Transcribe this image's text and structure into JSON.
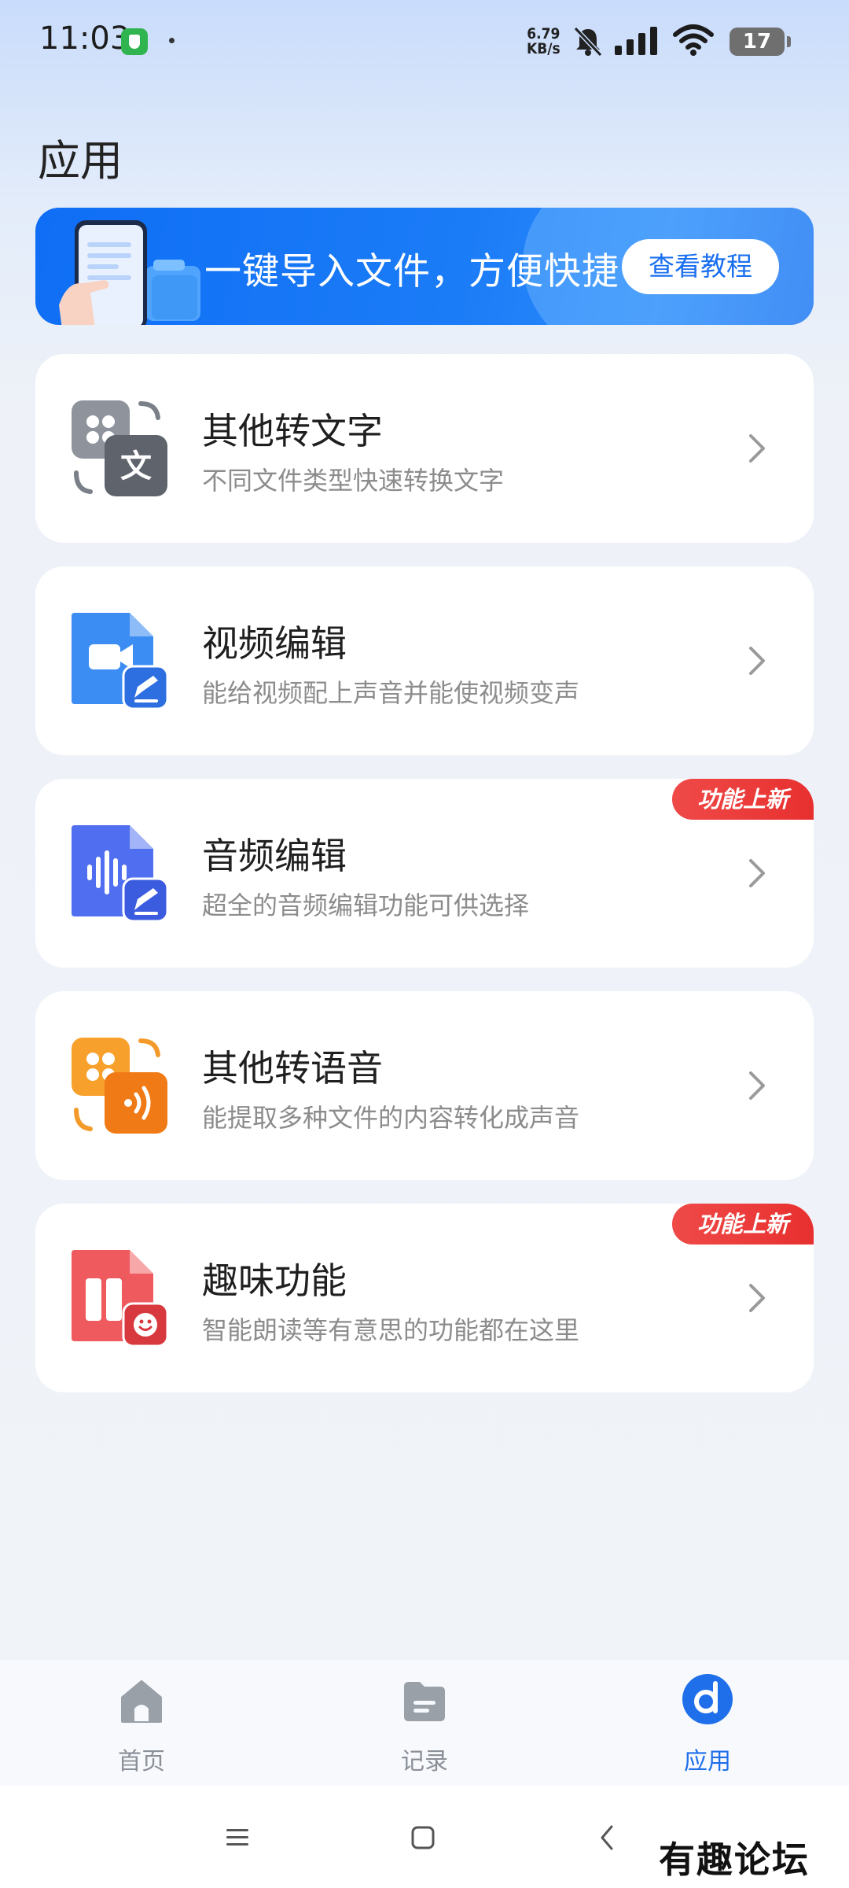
{
  "status_bar": {
    "time": "11:03",
    "net_speed_value": "6.79",
    "net_speed_unit": "KB/s",
    "battery": "17"
  },
  "page": {
    "title": "应用"
  },
  "banner": {
    "text": "一键导入文件，方便快捷",
    "button": "查看教程"
  },
  "cards": [
    {
      "title": "其他转文字",
      "subtitle": "不同文件类型快速转换文字",
      "icon": "text-convert-icon",
      "badge": ""
    },
    {
      "title": "视频编辑",
      "subtitle": "能给视频配上声音并能使视频变声",
      "icon": "video-edit-icon",
      "badge": ""
    },
    {
      "title": "音频编辑",
      "subtitle": "超全的音频编辑功能可供选择",
      "icon": "audio-edit-icon",
      "badge": "功能上新"
    },
    {
      "title": "其他转语音",
      "subtitle": "能提取多种文件的内容转化成声音",
      "icon": "voice-convert-icon",
      "badge": ""
    },
    {
      "title": "趣味功能",
      "subtitle": "智能朗读等有意思的功能都在这里",
      "icon": "fun-feature-icon",
      "badge": "功能上新"
    }
  ],
  "tabs": [
    {
      "label": "首页",
      "icon": "home-icon",
      "active": false
    },
    {
      "label": "记录",
      "icon": "folder-icon",
      "active": false
    },
    {
      "label": "应用",
      "icon": "app-icon",
      "active": true
    }
  ],
  "watermark": "有趣论坛",
  "colors": {
    "accent": "#1f6fea",
    "badge": "#e7302f",
    "banner": "#1b7cf7"
  }
}
